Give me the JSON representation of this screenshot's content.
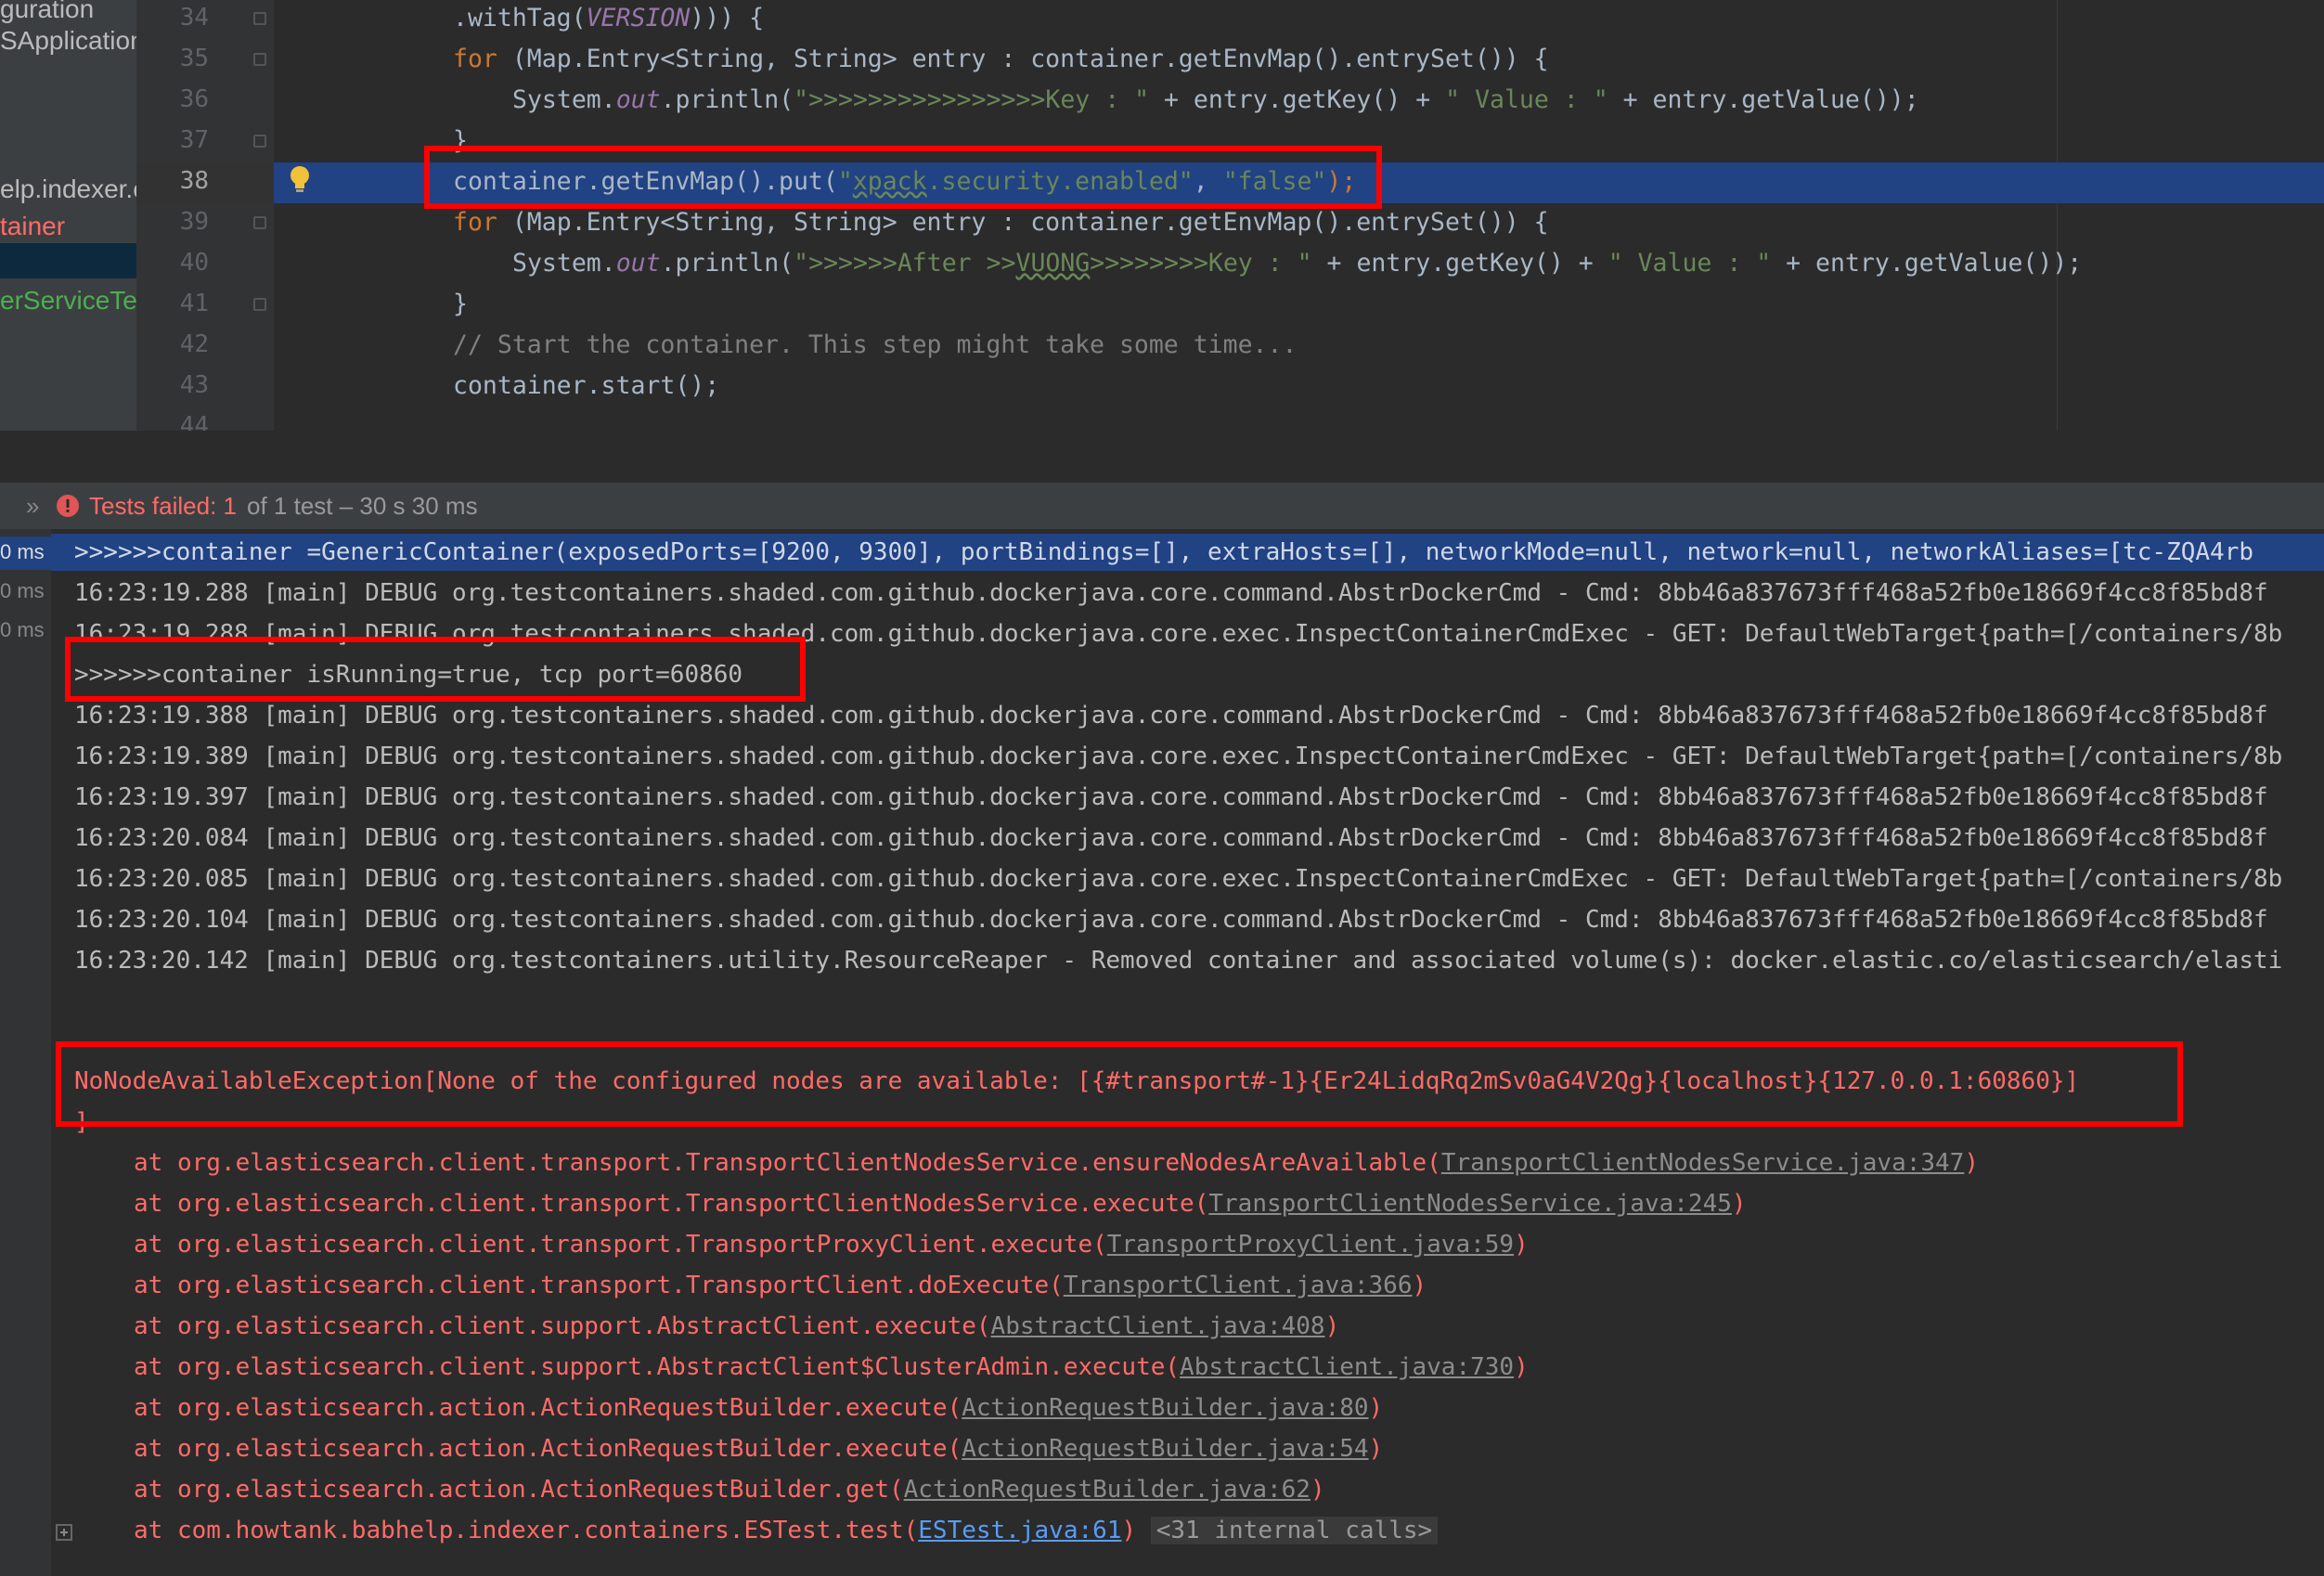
{
  "left_panel": {
    "items": [
      {
        "label": "guration",
        "color": "#bbbbbb"
      },
      {
        "label": "SApplication",
        "color": "#bbbbbb"
      },
      {
        "label": "elp.indexer.c",
        "color": "#bbbbbb"
      },
      {
        "label": "tainer",
        "color": "#ff6b68"
      },
      {
        "label": "erServiceTes",
        "color": "#4caf50"
      }
    ]
  },
  "editor": {
    "line_numbers": [
      "34",
      "35",
      "36",
      "37",
      "38",
      "39",
      "40",
      "41",
      "42",
      "43",
      "44"
    ],
    "highlighted_line": "38",
    "lines": {
      "l34_a": ".withTag(",
      "l34_b": "VERSION",
      "l34_c": "))) {",
      "l35_kw": "for",
      "l35_rest": " (Map.Entry<String, String> entry : container.getEnvMap().entrySet()) {",
      "l36_a": "System.",
      "l36_b": "out",
      "l36_c": ".println(",
      "l36_d": "\">>>>>>>>>>>>>>>>Key : \"",
      "l36_e": " + entry.getKey() + ",
      "l36_f": "\" Value : \"",
      "l36_g": " + entry.getValue());",
      "l37": "}",
      "l38_a": "container.getEnvMap().put(",
      "l38_b": "\"",
      "l38_c": "xpack",
      "l38_d": ".security.enabled\"",
      "l38_e": ", ",
      "l38_f": "\"false\"",
      "l38_g": ");",
      "l39_kw": "for",
      "l39_rest": " (Map.Entry<String, String> entry : container.getEnvMap().entrySet()) {",
      "l40_a": "System.",
      "l40_b": "out",
      "l40_c": ".println(",
      "l40_d": "\">>>>>>After >>",
      "l40_e": "VUONG",
      "l40_f": ">>>>>>>>Key : \"",
      "l40_g": " + entry.getKey() + ",
      "l40_h": "\" Value : \"",
      "l40_i": " + entry.getValue());",
      "l41": "}",
      "l42": "// Start the container. This step might take some time...",
      "l43": "container.start();"
    }
  },
  "test_status": {
    "chevron": "»",
    "failed_label": "Tests failed: 1",
    "failed_rest": " of 1 test – 30 s 30 ms"
  },
  "console_gutter": [
    "0 ms",
    "0 ms",
    "0 ms"
  ],
  "console": {
    "l1": ">>>>>>container =GenericContainer(exposedPorts=[9200, 9300], portBindings=[], extraHosts=[], networkMode=null, network=null, networkAliases=[tc-ZQA4rb",
    "l2": "16:23:19.288 [main] DEBUG org.testcontainers.shaded.com.github.dockerjava.core.command.AbstrDockerCmd - Cmd: 8bb46a837673fff468a52fb0e18669f4cc8f85bd8f",
    "l3": "16:23:19.288 [main] DEBUG org.testcontainers.shaded.com.github.dockerjava.core.exec.InspectContainerCmdExec - GET: DefaultWebTarget{path=[/containers/8b",
    "l4": ">>>>>>container isRunning=true, tcp port=60860",
    "l5": "16:23:19.388 [main] DEBUG org.testcontainers.shaded.com.github.dockerjava.core.command.AbstrDockerCmd - Cmd: 8bb46a837673fff468a52fb0e18669f4cc8f85bd8f",
    "l6": "16:23:19.389 [main] DEBUG org.testcontainers.shaded.com.github.dockerjava.core.exec.InspectContainerCmdExec - GET: DefaultWebTarget{path=[/containers/8b",
    "l7": "16:23:19.397 [main] DEBUG org.testcontainers.shaded.com.github.dockerjava.core.command.AbstrDockerCmd - Cmd: 8bb46a837673fff468a52fb0e18669f4cc8f85bd8f",
    "l8": "16:23:20.084 [main] DEBUG org.testcontainers.shaded.com.github.dockerjava.core.command.AbstrDockerCmd - Cmd: 8bb46a837673fff468a52fb0e18669f4cc8f85bd8f",
    "l9": "16:23:20.085 [main] DEBUG org.testcontainers.shaded.com.github.dockerjava.core.exec.InspectContainerCmdExec - GET: DefaultWebTarget{path=[/containers/8b",
    "l10": "16:23:20.104 [main] DEBUG org.testcontainers.shaded.com.github.dockerjava.core.command.AbstrDockerCmd - Cmd: 8bb46a837673fff468a52fb0e18669f4cc8f85bd8f",
    "l11": "16:23:20.142 [main] DEBUG org.testcontainers.utility.ResourceReaper - Removed container and associated volume(s): docker.elastic.co/elasticsearch/elasti",
    "exc": "NoNodeAvailableException[None of the configured nodes are available: [{#transport#-1}{Er24LidqRq2mSv0aG4V2Qg}{localhost}{127.0.0.1:60860}]",
    "exc_close": "]",
    "stack": [
      {
        "text": "at org.elasticsearch.client.transport.TransportClientNodesService.ensureNodesAreAvailable(",
        "link": "TransportClientNodesService.java:347"
      },
      {
        "text": "at org.elasticsearch.client.transport.TransportClientNodesService.execute(",
        "link": "TransportClientNodesService.java:245"
      },
      {
        "text": "at org.elasticsearch.client.transport.TransportProxyClient.execute(",
        "link": "TransportProxyClient.java:59"
      },
      {
        "text": "at org.elasticsearch.client.transport.TransportClient.doExecute(",
        "link": "TransportClient.java:366"
      },
      {
        "text": "at org.elasticsearch.client.support.AbstractClient.execute(",
        "link": "AbstractClient.java:408"
      },
      {
        "text": "at org.elasticsearch.client.support.AbstractClient$ClusterAdmin.execute(",
        "link": "AbstractClient.java:730"
      },
      {
        "text": "at org.elasticsearch.action.ActionRequestBuilder.execute(",
        "link": "ActionRequestBuilder.java:80"
      },
      {
        "text": "at org.elasticsearch.action.ActionRequestBuilder.execute(",
        "link": "ActionRequestBuilder.java:54"
      },
      {
        "text": "at org.elasticsearch.action.ActionRequestBuilder.get(",
        "link": "ActionRequestBuilder.java:62"
      },
      {
        "text": "at com.howtank.babhelp.indexer.containers.ESTest.test(",
        "link": "ESTest.java:61"
      }
    ],
    "internal_calls": "<31 internal calls>",
    "close_paren": ")"
  }
}
